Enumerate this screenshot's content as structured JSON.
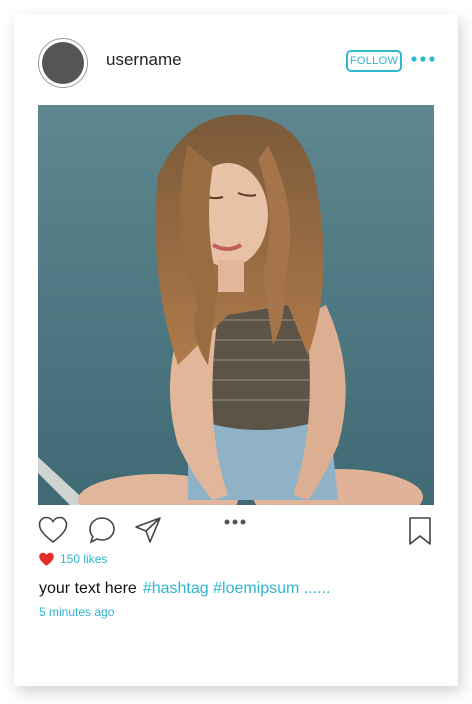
{
  "post": {
    "username": "username",
    "follow_label": "FOLLOW",
    "likes_label": "150 likes",
    "caption_text": "your text here",
    "hashtags": "#hashtag #loemipsum ......",
    "time_ago": "5 minutes ago"
  },
  "icons": {
    "more": "more-dots-icon",
    "like": "heart-outline-icon",
    "comment": "comment-icon",
    "share": "send-icon",
    "carousel": "carousel-dots-icon",
    "save": "bookmark-icon",
    "liked": "heart-filled-icon"
  },
  "colors": {
    "accent": "#2fb6d1",
    "like_red": "#e32b2b",
    "avatar": "#555555",
    "photo_wall": "#4f7b85"
  }
}
